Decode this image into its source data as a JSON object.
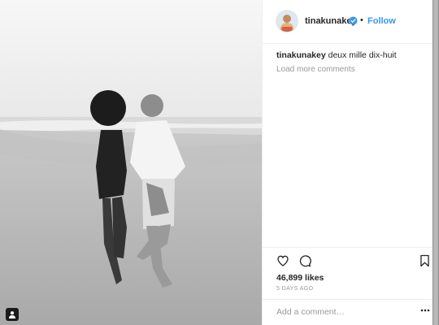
{
  "post": {
    "username": "tinakunakey",
    "follow_label": "Follow",
    "separator": "•",
    "caption_user": "tinakunakey",
    "caption_text": "deux mille dix-huit",
    "load_more": "Load more comments",
    "likes": "46,899 likes",
    "time": "5 DAYS AGO",
    "comment_placeholder": "Add a comment…"
  },
  "icons": {
    "avatar": "avatar",
    "verified": "verified-badge-icon",
    "like": "heart-icon",
    "comment": "comment-icon",
    "save": "bookmark-icon",
    "more": "more-options-icon",
    "tagged": "user-tag-icon"
  },
  "colors": {
    "accent": "#3897f0",
    "text": "#262626",
    "muted": "#999999",
    "border": "#efefef"
  }
}
